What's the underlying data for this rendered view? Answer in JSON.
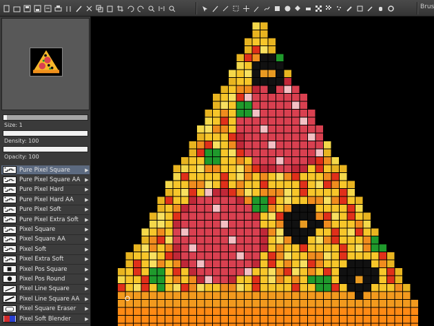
{
  "toolbar": {
    "file_tools": [
      "new-icon",
      "open-icon",
      "save-icon",
      "save-as-icon",
      "export-icon",
      "print-icon",
      "properties-icon",
      "brush-settings-icon",
      "cut-icon",
      "copy-icon",
      "paste-icon",
      "crop-icon",
      "undo-icon",
      "redo-icon",
      "zoom-in-icon",
      "flip-icon",
      "zoom-icon"
    ],
    "draw_tools": [
      "select-icon",
      "pen-icon",
      "line-icon",
      "rect-select-icon",
      "move-icon",
      "wand-icon",
      "stroke-icon",
      "rectangle-icon",
      "ellipse-icon",
      "fill-icon",
      "eraser-icon",
      "pattern-icon",
      "gradient-icon",
      "spray-icon",
      "smudge-icon",
      "clone-icon",
      "eyedropper-icon",
      "hand-icon",
      "settings-icon"
    ],
    "brush_label": "Brus"
  },
  "properties": {
    "size_label": "Size: 1",
    "size": 0.04,
    "density_label": "Density: 100",
    "density": 1.0,
    "opacity_label": "Opacity: 100",
    "opacity": 1.0
  },
  "brushes": [
    {
      "label": "Pure Pixel Square",
      "selected": true,
      "icon": "pixel-square"
    },
    {
      "label": "Pure Pixel Square AA",
      "selected": false,
      "icon": "pixel-square"
    },
    {
      "label": "Pure Pixel Hard",
      "selected": false,
      "icon": "pixel-square"
    },
    {
      "label": "Pure Pixel Hard AA",
      "selected": false,
      "icon": "pixel-square"
    },
    {
      "label": "Pure Pixel Soft",
      "selected": false,
      "icon": "pixel-square"
    },
    {
      "label": "Pure Pixel Extra Soft",
      "selected": false,
      "icon": "pixel-square"
    },
    {
      "label": "Pixel Square",
      "selected": false,
      "icon": "pixel-square"
    },
    {
      "label": "Pixel Square AA",
      "selected": false,
      "icon": "pixel-square"
    },
    {
      "label": "Pixel Soft",
      "selected": false,
      "icon": "pixel-square"
    },
    {
      "label": "Pixel Extra Soft",
      "selected": false,
      "icon": "pixel-square"
    },
    {
      "label": "Pixel Pos Square",
      "selected": false,
      "icon": "pos-square"
    },
    {
      "label": "Pixel Pos Round",
      "selected": false,
      "icon": "pos-round"
    },
    {
      "label": "Pixel Line Square",
      "selected": false,
      "icon": "line-square"
    },
    {
      "label": "Pixel Line Square AA",
      "selected": false,
      "icon": "line-square-aa"
    },
    {
      "label": "Pixel Square Eraser",
      "selected": false,
      "icon": "eraser"
    },
    {
      "label": "Pixel Soft Blender",
      "selected": false,
      "icon": "blender"
    }
  ],
  "colors": {
    "crust": "#f29a1e",
    "cheese": "#f7c62a",
    "sauce": "#e0301a",
    "salami": "#d94050",
    "salami_spot": "#f4c0c4",
    "olive": "#111111",
    "olive_ring": "#e89a22",
    "basil": "#1f9a2c",
    "grid": "#1a0a00"
  }
}
